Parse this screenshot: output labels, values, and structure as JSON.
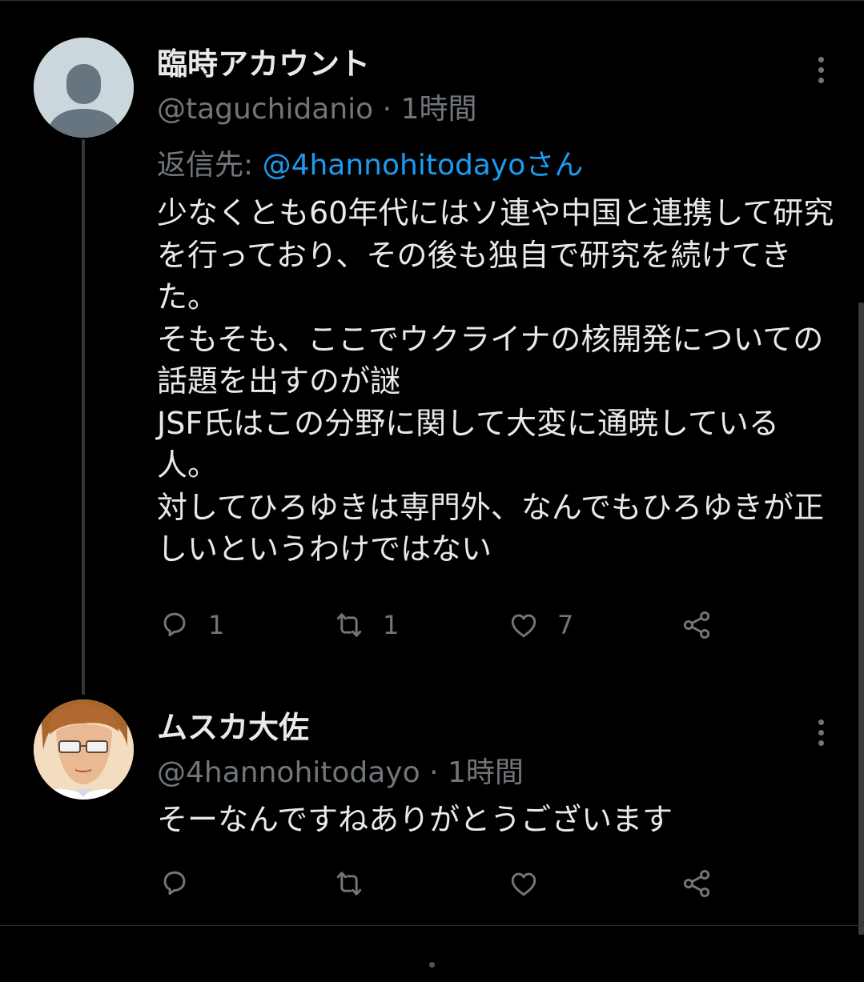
{
  "tweets": [
    {
      "name": "臨時アカウント",
      "handle": "@taguchidanio",
      "time": "1時間",
      "reply_prefix": "返信先: ",
      "reply_to": "@4hannohitodayoさん",
      "text": "少なくとも60年代にはソ連や中国と連携して研究を行っており、その後も独自で研究を続けてきた。\nそもそも、ここでウクライナの核開発についての話題を出すのが謎\nJSF氏はこの分野に関して大変に通暁している人。\n対してひろゆきは専門外、なんでもひろゆきが正しいというわけではない",
      "counts": {
        "replies": "1",
        "retweets": "1",
        "likes": "7"
      }
    },
    {
      "name": "ムスカ大佐",
      "handle": "@4hannohitodayo",
      "time": "1時間",
      "text": "そーなんですねありがとうございます"
    }
  ],
  "separator": " · ",
  "icons": [
    "default-avatar-icon",
    "more-icon",
    "reply-icon",
    "retweet-icon",
    "like-icon",
    "share-icon"
  ],
  "colors": {
    "background": "#000000",
    "text": "#e7e9ea",
    "muted": "#71767b",
    "link": "#1d9bf0",
    "divider": "#2f3336"
  }
}
